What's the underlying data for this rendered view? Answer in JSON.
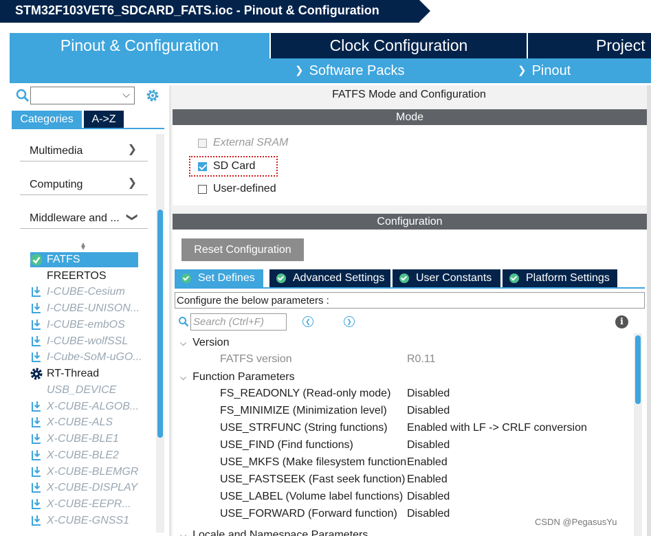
{
  "window": {
    "title": "STM32F103VET6_SDCARD_FATS.ioc - Pinout & Configuration"
  },
  "main_tabs": [
    {
      "label": "Pinout & Configuration",
      "active": true
    },
    {
      "label": "Clock Configuration",
      "active": false
    },
    {
      "label": "Project",
      "active": false
    }
  ],
  "sub_menu": {
    "software_packs": "Software Packs",
    "pinout": "Pinout"
  },
  "left_panel": {
    "search_value": "",
    "tabs": {
      "categories": "Categories",
      "az": "A->Z"
    },
    "categories": [
      {
        "label": "Multimedia",
        "expanded": false
      },
      {
        "label": "Computing",
        "expanded": false
      },
      {
        "label": "Middleware and ...",
        "expanded": true
      }
    ],
    "middleware": [
      {
        "label": "FATFS",
        "state": "enabled"
      },
      {
        "label": "FREERTOS",
        "state": "available"
      },
      {
        "label": "I-CUBE-Cesium",
        "state": "pack"
      },
      {
        "label": "I-CUBE-UNISON...",
        "state": "pack"
      },
      {
        "label": "I-CUBE-embOS",
        "state": "pack"
      },
      {
        "label": "I-CUBE-wolfSSL",
        "state": "pack"
      },
      {
        "label": "I-Cube-SoM-uGO...",
        "state": "pack"
      },
      {
        "label": "RT-Thread",
        "state": "configured"
      },
      {
        "label": "USB_DEVICE",
        "state": "disabled"
      },
      {
        "label": "X-CUBE-ALGOB...",
        "state": "pack"
      },
      {
        "label": "X-CUBE-ALS",
        "state": "pack"
      },
      {
        "label": "X-CUBE-BLE1",
        "state": "pack"
      },
      {
        "label": "X-CUBE-BLE2",
        "state": "pack"
      },
      {
        "label": "X-CUBE-BLEMGR",
        "state": "pack"
      },
      {
        "label": "X-CUBE-DISPLAY",
        "state": "pack"
      },
      {
        "label": "X-CUBE-EEPR...",
        "state": "pack"
      },
      {
        "label": "X-CUBE-GNSS1",
        "state": "pack"
      }
    ]
  },
  "right_panel": {
    "title": "FATFS Mode and Configuration",
    "mode_header": "Mode",
    "mode_options": [
      {
        "label": "External SRAM",
        "checked": false,
        "disabled": true
      },
      {
        "label": "SD Card",
        "checked": true,
        "disabled": false
      },
      {
        "label": "User-defined",
        "checked": false,
        "disabled": false
      }
    ],
    "config_header": "Configuration",
    "reset_button": "Reset Configuration",
    "config_tabs": [
      {
        "label": "Set Defines",
        "active": true
      },
      {
        "label": "Advanced Settings",
        "active": false
      },
      {
        "label": "User Constants",
        "active": false
      },
      {
        "label": "Platform Settings",
        "active": false
      }
    ],
    "param_hint": "Configure the below parameters :",
    "search_placeholder": "Search (Ctrl+F)",
    "groups": {
      "version": {
        "label": "Version",
        "rows": [
          {
            "name": "FATFS version",
            "value": "R0.11"
          }
        ]
      },
      "function_params": {
        "label": "Function Parameters",
        "rows": [
          {
            "name": "FS_READONLY (Read-only mode)",
            "value": "Disabled"
          },
          {
            "name": "FS_MINIMIZE (Minimization level)",
            "value": "Disabled"
          },
          {
            "name": "USE_STRFUNC (String functions)",
            "value": "Enabled with LF -> CRLF conversion"
          },
          {
            "name": "USE_FIND (Find functions)",
            "value": "Disabled"
          },
          {
            "name": "USE_MKFS (Make filesystem function)",
            "value": "Enabled"
          },
          {
            "name": "USE_FASTSEEK (Fast seek function)",
            "value": "Enabled"
          },
          {
            "name": "USE_LABEL (Volume label functions)",
            "value": "Disabled"
          },
          {
            "name": "USE_FORWARD (Forward function)",
            "value": "Disabled"
          }
        ]
      },
      "next_group_label": "Locale and Namespace Parameters"
    }
  },
  "watermark": "CSDN @PegasusYu",
  "colors": {
    "accent": "#3ea5dd",
    "navy": "#03234b",
    "header_gray": "#5f6368"
  }
}
